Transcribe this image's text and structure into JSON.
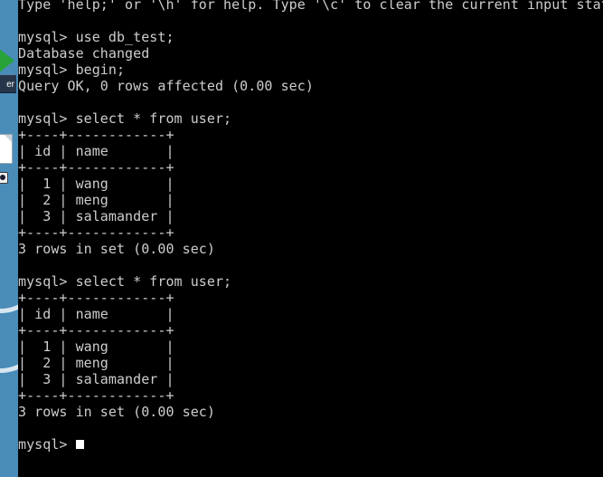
{
  "desktop": {
    "background_color": "#4a8cb8",
    "play_icon_color": "#27a339",
    "taskbar_item_label": "er",
    "icons": [
      {
        "name": "play-triangle-icon"
      },
      {
        "name": "document-icon"
      },
      {
        "name": "badge-icon"
      }
    ]
  },
  "terminal": {
    "background_color": "#000000",
    "text_color": "#cdcdcd",
    "cursor_color": "#ffffff",
    "prompt": "mysql>",
    "lines": [
      "Type 'help;' or '\\h' for help. Type '\\c' to clear the current input state",
      "",
      "mysql> use db_test;",
      "Database changed",
      "mysql> begin;",
      "Query OK, 0 rows affected (0.00 sec)",
      "",
      "mysql> select * from user;",
      "+----+------------+",
      "| id | name       |",
      "+----+------------+",
      "|  1 | wang       |",
      "|  2 | meng       |",
      "|  3 | salamander |",
      "+----+------------+",
      "3 rows in set (0.00 sec)",
      "",
      "mysql> select * from user;",
      "+----+------------+",
      "| id | name       |",
      "+----+------------+",
      "|  1 | wang       |",
      "|  2 | meng       |",
      "|  3 | salamander |",
      "+----+------------+",
      "3 rows in set (0.00 sec)",
      "",
      "mysql>"
    ],
    "result_table": {
      "columns": [
        "id",
        "name"
      ],
      "rows": [
        [
          "1",
          "wang"
        ],
        [
          "2",
          "meng"
        ],
        [
          "3",
          "salamander"
        ]
      ],
      "row_count_text": "3 rows in set (0.00 sec)"
    },
    "commands": [
      "use db_test;",
      "begin;",
      "select * from user;",
      "select * from user;"
    ],
    "status_messages": [
      "Database changed",
      "Query OK, 0 rows affected (0.00 sec)"
    ]
  }
}
